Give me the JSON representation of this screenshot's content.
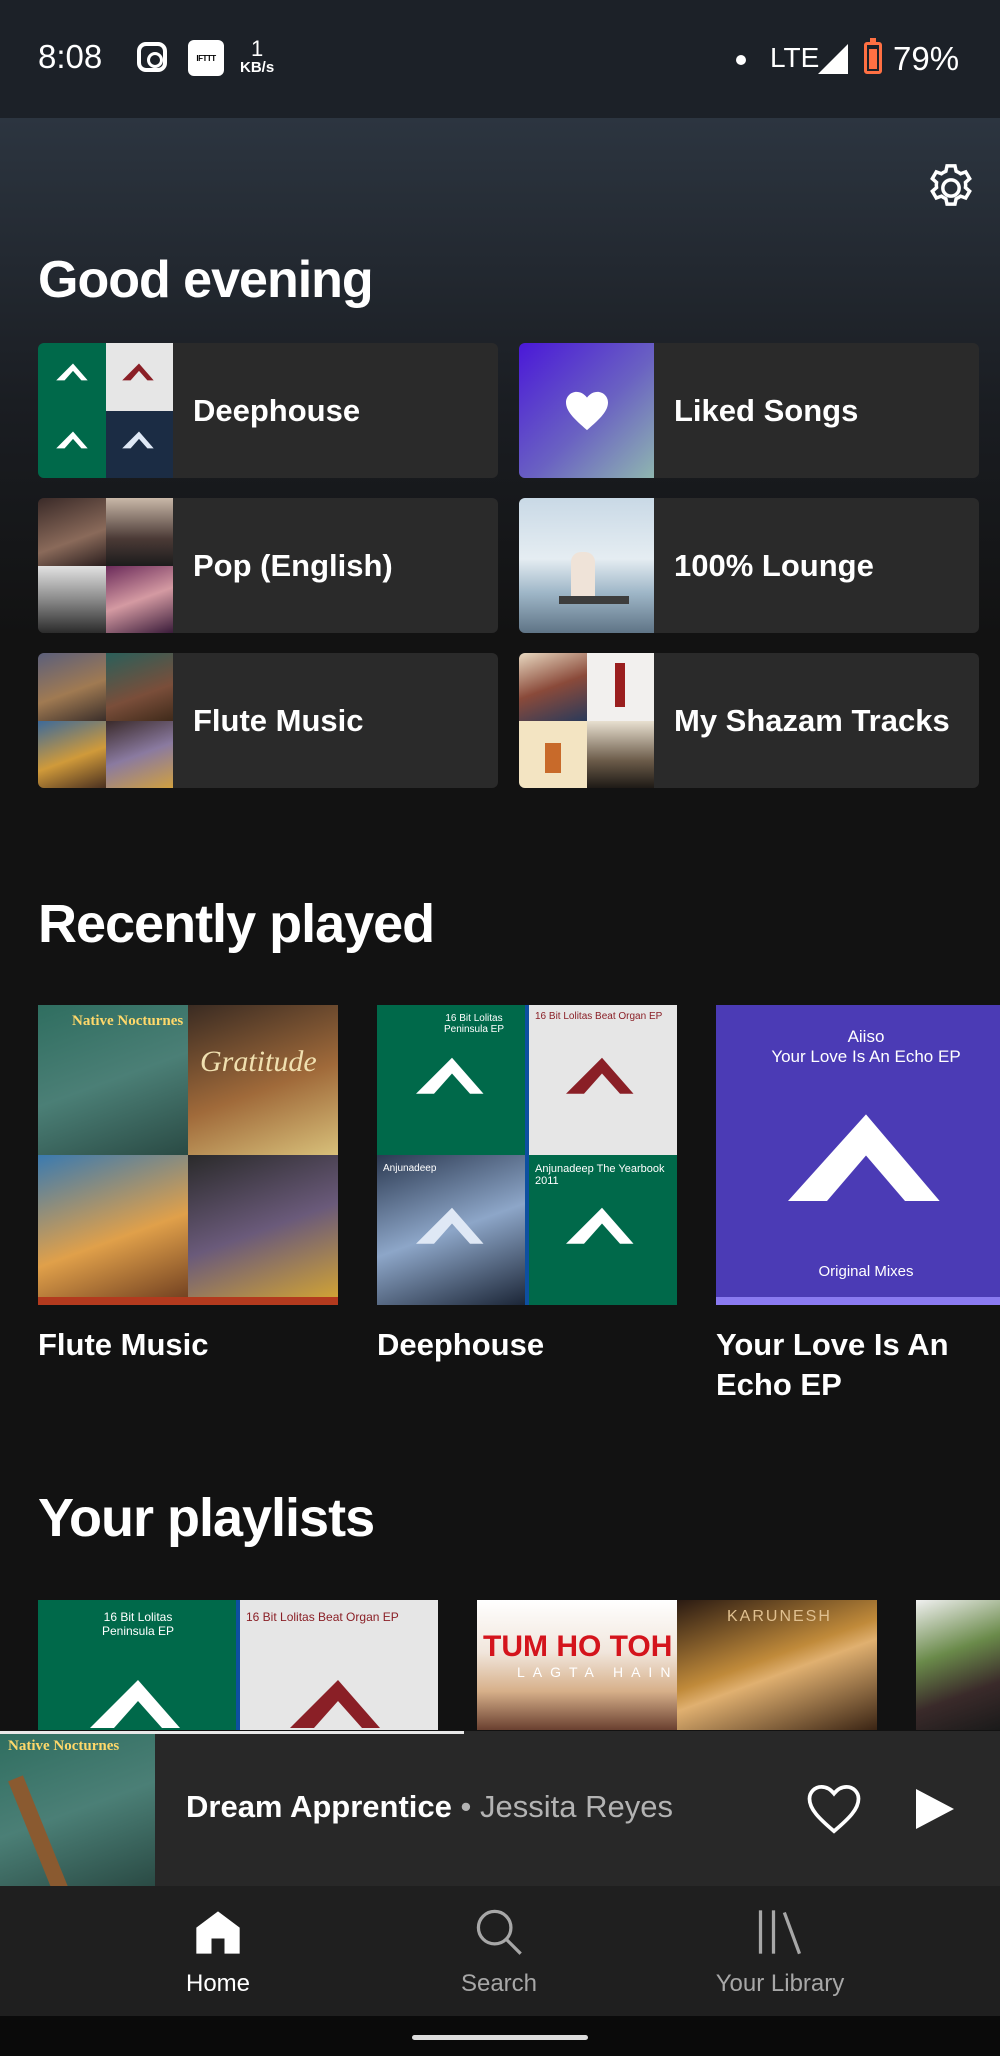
{
  "status_bar": {
    "time": "8:08",
    "ifttt": "IFTTT",
    "net_speed_value": "1",
    "net_speed_unit": "KB/s",
    "network": "LTE",
    "battery": "79%"
  },
  "header": {
    "greeting": "Good evening"
  },
  "shortcuts": [
    {
      "label": "Deephouse"
    },
    {
      "label": "Liked Songs"
    },
    {
      "label": "Pop (English)"
    },
    {
      "label": "100% Lounge"
    },
    {
      "label": "Flute Music"
    },
    {
      "label": "My Shazam Tracks"
    }
  ],
  "recently_played": {
    "title": "Recently played",
    "items": [
      {
        "title": "Flute Music"
      },
      {
        "title": "Deephouse"
      },
      {
        "title": "Your Love Is An Echo EP"
      }
    ],
    "echo_cover_artist": "Aiiso",
    "echo_cover_title": "Your Love Is An Echo EP",
    "echo_cover_sub": "Original Mixes",
    "deep_cover_tl": "16 Bit Lolitas Peninsula EP",
    "deep_cover_tr": "16 Bit Lolitas Beat Organ EP",
    "deep_cover_br": "Anjunadeep The Yearbook 2011",
    "deep_cover_bl": "Anjunadeep",
    "flute_cover_tl": "Native Nocturnes",
    "flute_cover_tr": "Gratitude"
  },
  "playlists": {
    "title": "Your playlists",
    "cover2_text": "TUM HO TOH",
    "cover2_sub": "LAGTA HAIN",
    "cover2_right": "KARUNESH"
  },
  "now_playing": {
    "title": "Dream Apprentice",
    "separator": " • ",
    "artist": "Jessita Reyes",
    "cover_text": "Native Nocturnes"
  },
  "bottom_nav": {
    "items": [
      {
        "label": "Home"
      },
      {
        "label": "Search"
      },
      {
        "label": "Your Library"
      }
    ]
  },
  "colors": {
    "background": "#121212",
    "card": "#2a2a2a",
    "player": "#282828",
    "nav": "#1f1f1f",
    "muted_text": "#b3b3b3"
  }
}
